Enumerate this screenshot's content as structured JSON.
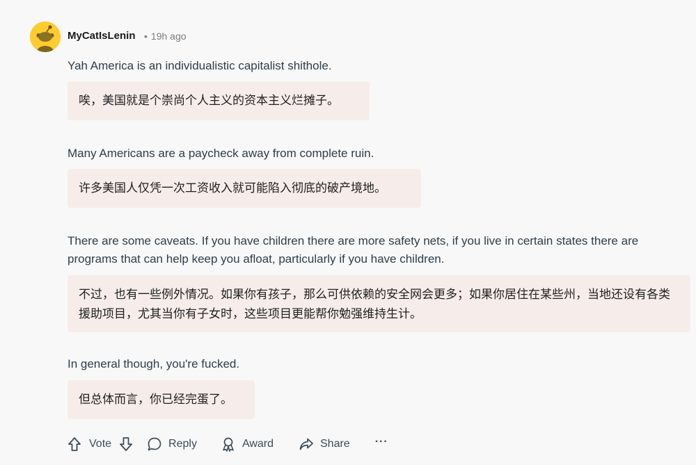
{
  "comment": {
    "username": "MyCatIsLenin",
    "separator": "•",
    "time": "19h ago",
    "paragraphs": [
      {
        "en": "Yah America is an individualistic capitalist shithole.",
        "zh": "唉，美国就是个崇尚个人主义的资本主义烂摊子。"
      },
      {
        "en": "Many Americans are a paycheck away from complete ruin.",
        "zh": "许多美国人仅凭一次工资收入就可能陷入彻底的破产境地。"
      },
      {
        "en": "There are some caveats. If you have children there are more safety nets, if you live in certain states there are programs that can help keep you afloat, particularly if you have children.",
        "zh": "不过，也有一些例外情况。如果你有孩子，那么可供依赖的安全网会更多；如果你居住在某些州，当地还设有各类援助项目，尤其当你有子女时，这些项目更能帮你勉强维持生计。"
      },
      {
        "en": "In general though, you're fucked.",
        "zh": "但总体而言，你已经完蛋了。"
      }
    ]
  },
  "actions": {
    "vote_label": "Vote",
    "reply_label": "Reply",
    "award_label": "Award",
    "share_label": "Share",
    "more_label": "···"
  },
  "icons": {
    "avatar": "reddit-snoo-icon",
    "upvote": "arrow-up-icon",
    "downvote": "arrow-down-icon",
    "reply": "speech-bubble-icon",
    "award": "award-icon",
    "share": "share-arrow-icon",
    "more": "ellipsis-icon"
  },
  "colors": {
    "background": "#f8f8f8",
    "translation_box": "#f6edeb",
    "avatar_bg": "#ffcc2f"
  }
}
